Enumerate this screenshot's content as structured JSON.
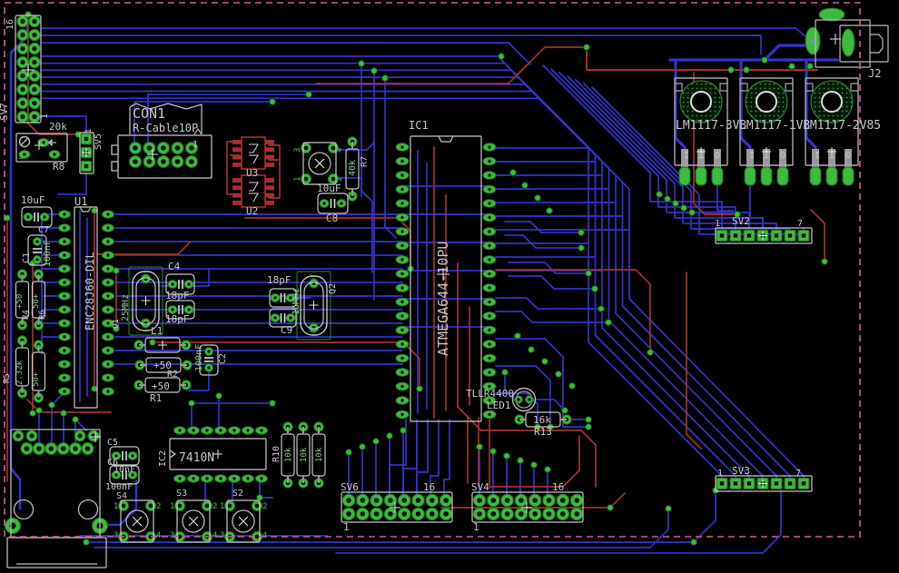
{
  "app": {
    "view": "pcb-board-layout"
  },
  "colors": {
    "background": "#000000",
    "copper_bottom_blue": "#3333cc",
    "copper_top_red": "#a53030",
    "pad_green": "#3dbb3d",
    "pad_dark": "#1d6e1d",
    "hole_dark": "#0b0b0b",
    "via_green": "#3bbf3b",
    "silkscreen": "#c8c8c8",
    "text_gray": "#c8c8c8",
    "text_green": "#56b856",
    "board_outline_pink": "#d4608c"
  },
  "components": {
    "sv7": {
      "name": "SV7",
      "pin1": "1",
      "pin16": "16"
    },
    "r8": {
      "name": "R8",
      "value": "20k",
      "pad1": "1",
      "pad3": "3"
    },
    "sv5": {
      "name": "SV5",
      "pin1": "1"
    },
    "c7": {
      "name": "C7",
      "value": "10uF"
    },
    "c1": {
      "name": "C1",
      "value": "100nF"
    },
    "u1": {
      "name": "U1",
      "value": "ENC28J60-DIL"
    },
    "q1": {
      "name": "Q1",
      "value": "25MHz"
    },
    "c4": {
      "name": "C4",
      "value": "18pF"
    },
    "c4b": {
      "value": "18pF"
    },
    "q2": {
      "name": "Q2",
      "value": "16MHz"
    },
    "c9": {
      "name": "C9",
      "value": "18pF"
    },
    "l1": {
      "name": "L1"
    },
    "r2": {
      "name": "R2",
      "value": "+50"
    },
    "r1": {
      "name": "R1",
      "value": "+50"
    },
    "c2": {
      "name": "C2",
      "value": "100nF"
    },
    "r4": {
      "name": "R4",
      "value": "+50"
    },
    "r6": {
      "name": "R6",
      "value": "50+"
    },
    "r5": {
      "name": "R5",
      "value": "2.32k"
    },
    "r5b": {
      "value": "50+"
    },
    "con1": {
      "name": "CON1",
      "value": "R-Cable10P",
      "pin1": "1"
    },
    "u3": {
      "name": "U3"
    },
    "u2": {
      "name": "U2"
    },
    "r7": {
      "name": "R7",
      "value": "40k"
    },
    "c8": {
      "name": "C8",
      "value": "10uF"
    },
    "ic1": {
      "name": "IC1",
      "value": "ATMEGA644-10PU"
    },
    "led1": {
      "name": "LED1",
      "value": "TLLR4400"
    },
    "r13": {
      "name": "R13",
      "value": "16k"
    },
    "ic2": {
      "name": "IC2",
      "value": "7410N"
    },
    "r10": {
      "name": "R10",
      "values": [
        "10k",
        "10k",
        "10k"
      ]
    },
    "s4": {
      "name": "S4"
    },
    "s3": {
      "name": "S3"
    },
    "s2": {
      "name": "S2"
    },
    "c5": {
      "name": "C5"
    },
    "c6": {
      "name": "C6",
      "value": "10nF"
    },
    "c56": {
      "value": "100nF"
    },
    "sv6": {
      "name": "SV6",
      "pin1": "1",
      "pin16": "16"
    },
    "sv4": {
      "name": "SV4",
      "pin1": "1",
      "pin16": "16"
    },
    "sv2": {
      "name": "SV2",
      "pin1": "1",
      "pin7": "7"
    },
    "sv3": {
      "name": "SV3",
      "pin1": "1",
      "pin7": "7"
    },
    "vr1": {
      "name": "LM1117-3V3",
      "pin_in": "I",
      "pin_gnd": "⊥",
      "pin_out": "O"
    },
    "vr2": {
      "name": "LM1117-1V8",
      "pin_in": "I",
      "pin_gnd": "⊥",
      "pin_out": "O"
    },
    "vr3": {
      "name": "LM1117-2V85",
      "pin_in": "I",
      "pin_gnd": "⊥",
      "pin_out": "O"
    },
    "j2": {
      "name": "J2"
    }
  },
  "pad_digits": {
    "d1": "1",
    "d2": "2",
    "d3": "3",
    "d4": "4"
  }
}
